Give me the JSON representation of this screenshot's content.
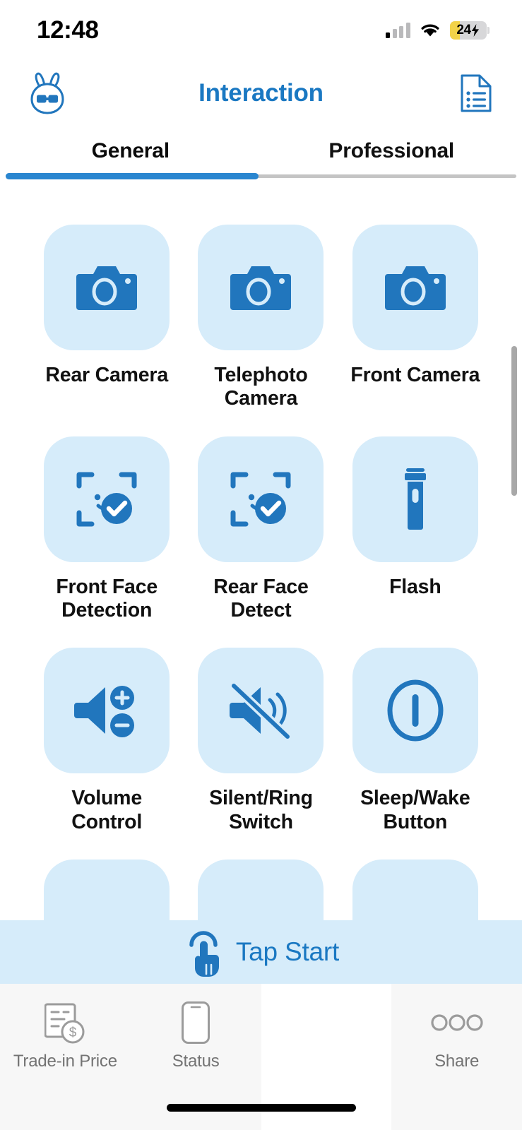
{
  "statusbar": {
    "time": "12:48",
    "signal_icon": "cellular-signal-icon",
    "wifi_icon": "wifi-icon",
    "battery_level": "24",
    "battery_icon": "battery-charging-icon"
  },
  "header": {
    "logo_icon": "rabbit-logo-icon",
    "title": "Interaction",
    "report_icon": "document-report-icon"
  },
  "tabs": [
    {
      "label": "General",
      "active": true
    },
    {
      "label": "Professional",
      "active": false
    }
  ],
  "grid": {
    "items": [
      {
        "label": "Rear Camera",
        "icon": "camera-icon"
      },
      {
        "label": "Telephoto Camera",
        "icon": "camera-icon"
      },
      {
        "label": "Front Camera",
        "icon": "camera-icon"
      },
      {
        "label": "Front Face Detection",
        "icon": "face-detection-icon"
      },
      {
        "label": "Rear Face Detect",
        "icon": "face-detection-icon"
      },
      {
        "label": "Flash",
        "icon": "flashlight-icon"
      },
      {
        "label": "Volume Control",
        "icon": "volume-control-icon"
      },
      {
        "label": "Silent/Ring Switch",
        "icon": "mute-switch-icon"
      },
      {
        "label": "Sleep/Wake Button",
        "icon": "power-button-icon"
      }
    ]
  },
  "tapbar": {
    "label": "Tap Start",
    "icon": "tap-hand-icon"
  },
  "bottomnav": {
    "items": [
      {
        "label": "Trade-in Price",
        "icon": "price-document-icon"
      },
      {
        "label": "Status",
        "icon": "phone-outline-icon"
      },
      {
        "label": "",
        "icon": ""
      },
      {
        "label": "Share",
        "icon": "share-dots-icon"
      }
    ]
  },
  "colors": {
    "accent": "#2a86d0",
    "title": "#1a78c2",
    "tile_bg": "#d6ecfa",
    "icon_blue": "#2176bd",
    "nav_gray": "#737373",
    "battery_yellow": "#f2d349"
  }
}
